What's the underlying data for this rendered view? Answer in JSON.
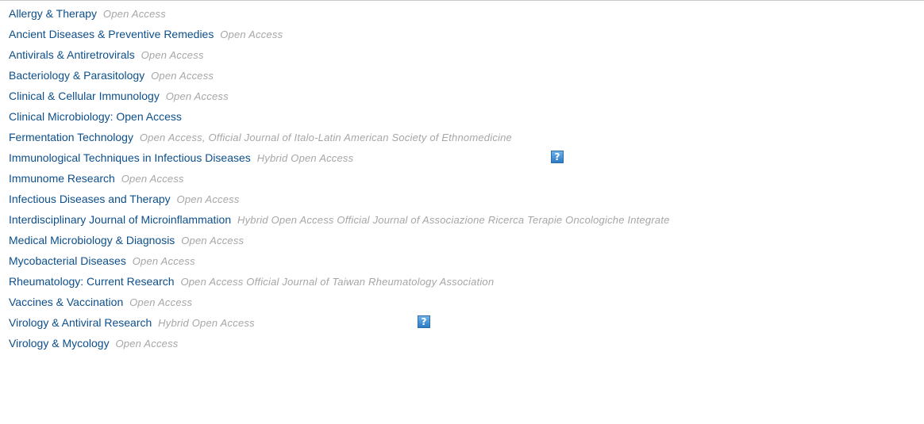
{
  "journals": [
    {
      "title": "Allergy & Therapy",
      "note": "Open Access"
    },
    {
      "title": "Ancient Diseases & Preventive Remedies",
      "note": "Open Access"
    },
    {
      "title": "Antivirals & Antiretrovirals",
      "note": "Open Access"
    },
    {
      "title": "Bacteriology & Parasitology",
      "note": "Open Access"
    },
    {
      "title": "Clinical & Cellular Immunology",
      "note": "Open Access"
    },
    {
      "title": "Clinical Microbiology: Open Access",
      "note": ""
    },
    {
      "title": "Fermentation Technology",
      "note": "Open Access, Official Journal of Italo-Latin American Society of Ethnomedicine"
    },
    {
      "title": "Immunological Techniques in Infectious Diseases",
      "note": "Hybrid Open Access"
    },
    {
      "title": "Immunome Research",
      "note": "Open Access"
    },
    {
      "title": "Infectious Diseases and Therapy",
      "note": "Open Access"
    },
    {
      "title": "Interdisciplinary Journal of Microinflammation",
      "note": "Hybrid Open Access Official Journal of Associazione Ricerca Terapie Oncologiche Integrate"
    },
    {
      "title": "Medical Microbiology & Diagnosis",
      "note": "Open Access"
    },
    {
      "title": "Mycobacterial Diseases",
      "note": "Open Access"
    },
    {
      "title": "Rheumatology: Current Research",
      "note": "Open Access Official Journal of Taiwan Rheumatology Association"
    },
    {
      "title": "Vaccines & Vaccination",
      "note": "Open Access"
    },
    {
      "title": "Virology & Antiviral Research",
      "note": "Hybrid Open Access"
    },
    {
      "title": "Virology & Mycology",
      "note": "Open Access"
    }
  ],
  "help_icon": {
    "glyph": "?",
    "icon": "help-icon",
    "color": "#2c7bc5"
  },
  "colors": {
    "link": "#0d4f8b",
    "note": "#a6a6a6"
  }
}
